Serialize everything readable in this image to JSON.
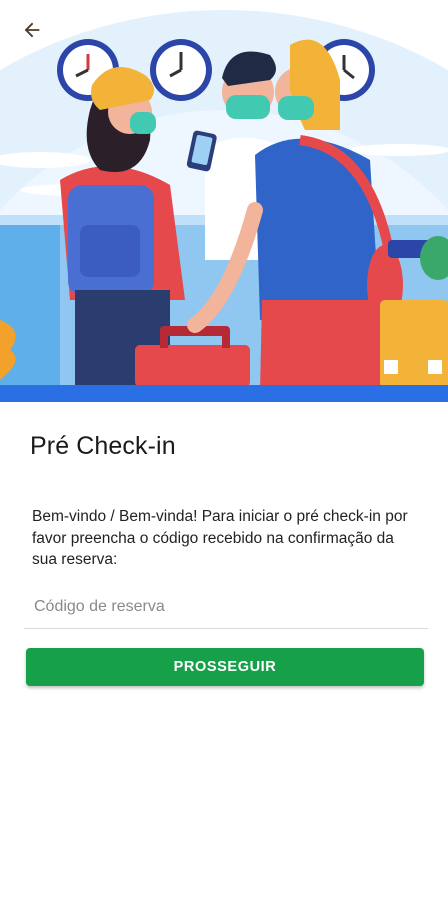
{
  "header": {
    "back_icon": "arrow-left-icon"
  },
  "page": {
    "title": "Pré Check-in"
  },
  "content": {
    "description": "Bem-vindo / Bem-vinda! Para iniciar o pré check-in por favor preencha o código recebido na confirmação da sua reserva:"
  },
  "form": {
    "reservation_code": {
      "value": "",
      "placeholder": "Código de reserva"
    },
    "submit_label": "PROSSEGUIR"
  },
  "colors": {
    "primary_button": "#17a04a",
    "hero_sky": "#e3f1fd",
    "hero_floor": "#2a6fe3"
  }
}
